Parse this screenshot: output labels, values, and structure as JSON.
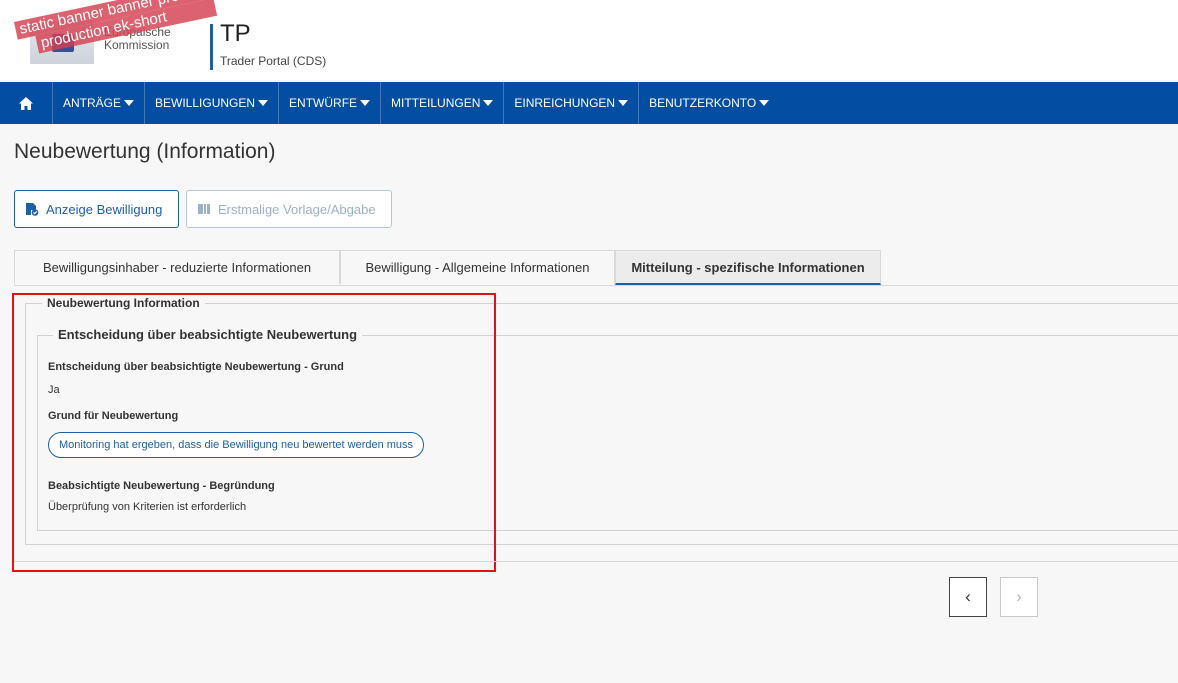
{
  "header": {
    "logo_text_line1": "Europäische",
    "logo_text_line2": "Kommission",
    "banner_line1": "static banner banner  pre-",
    "banner_line2": "production ek-short",
    "app_short": "TP",
    "app_subtitle": "Trader Portal (CDS)"
  },
  "nav": {
    "home_icon": "home-icon",
    "items": [
      {
        "label": "ANTRÄGE"
      },
      {
        "label": "BEWILLIGUNGEN"
      },
      {
        "label": "ENTWÜRFE"
      },
      {
        "label": "MITTEILUNGEN"
      },
      {
        "label": "EINREICHUNGEN"
      },
      {
        "label": "BENUTZERKONTO"
      }
    ]
  },
  "page": {
    "title": "Neubewertung (Information)"
  },
  "actions": {
    "view_label": "Anzeige Bewilligung",
    "initial_label": "Erstmalige Vorlage/Abgabe"
  },
  "tabs": [
    {
      "label": "Bewilligungsinhaber - reduzierte Informationen",
      "active": false
    },
    {
      "label": "Bewilligung - Allgemeine Informationen",
      "active": false
    },
    {
      "label": "Mitteilung - spezifische Informationen",
      "active": true
    }
  ],
  "content": {
    "outer_legend": "Neubewertung Information",
    "inner_legend": "Entscheidung über beabsichtigte Neubewertung",
    "fields": {
      "decision_reason_label": "Entscheidung über beabsichtigte Neubewertung - Grund",
      "decision_reason_value": "Ja",
      "reason_label": "Grund für Neubewertung",
      "reason_value": "Monitoring hat ergeben, dass die Bewilligung neu bewertet werden muss",
      "justification_label": "Beabsichtigte Neubewertung - Begründung",
      "justification_value": "Überprüfung von Kriterien ist erforderlich"
    }
  },
  "pagination": {
    "prev": "‹",
    "next": "›"
  },
  "colors": {
    "nav_bg": "#034ea2",
    "accent": "#1f5fa6",
    "highlight": "#e01212"
  }
}
